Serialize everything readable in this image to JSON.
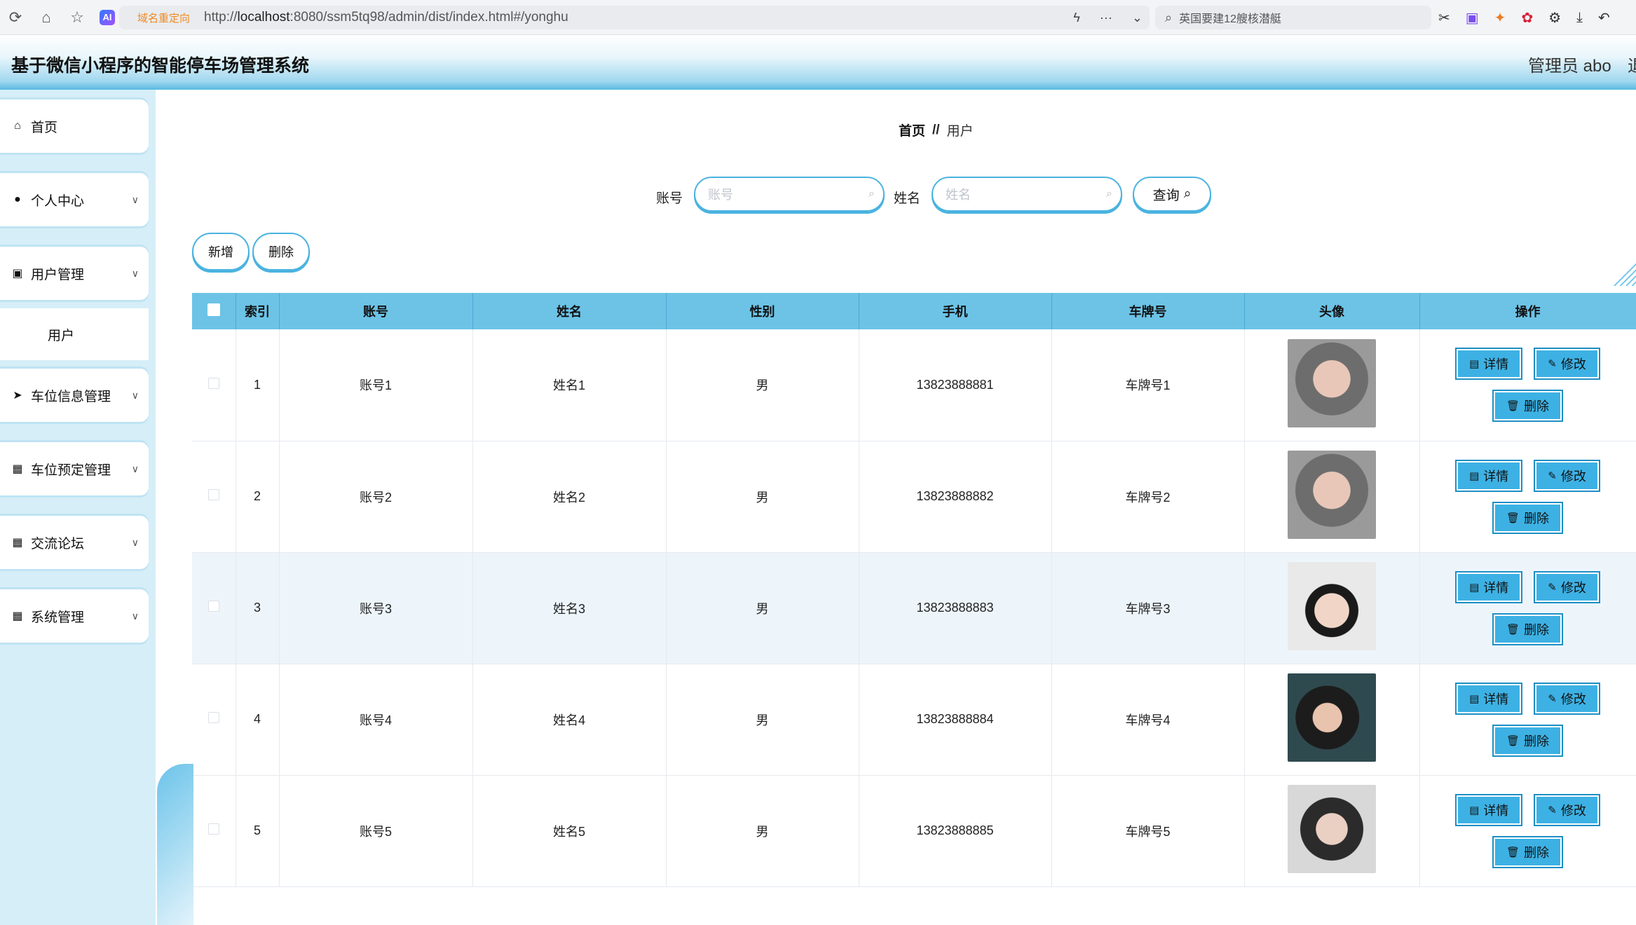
{
  "browser": {
    "redirect_tag": "域名重定向",
    "url_prefix": "http://",
    "url_host": "localhost",
    "url_rest": ":8080/ssm5tq98/admin/dist/index.html#/yonghu",
    "search_text": "英国要建12艘核潜艇",
    "ai_label": "AI"
  },
  "header": {
    "title": "基于微信小程序的智能停车场管理系统",
    "admin": "管理员 abo",
    "exit": "退"
  },
  "sidebar": {
    "items": [
      {
        "label": "首页"
      },
      {
        "label": "个人中心"
      },
      {
        "label": "用户管理"
      },
      {
        "label": "用户"
      },
      {
        "label": "车位信息管理"
      },
      {
        "label": "车位预定管理"
      },
      {
        "label": "交流论坛"
      },
      {
        "label": "系统管理"
      }
    ]
  },
  "breadcrumb": {
    "home": "首页",
    "sep": "//",
    "current": "用户"
  },
  "search": {
    "account_label": "账号",
    "account_placeholder": "账号",
    "name_label": "姓名",
    "name_placeholder": "姓名",
    "query_label": "查询"
  },
  "actions": {
    "add": "新增",
    "delete": "删除"
  },
  "table": {
    "headers": [
      "索引",
      "账号",
      "姓名",
      "性别",
      "手机",
      "车牌号",
      "头像",
      "操作"
    ],
    "rows": [
      {
        "index": "1",
        "account": "账号1",
        "name": "姓名1",
        "gender": "男",
        "phone": "13823888881",
        "plate": "车牌号1"
      },
      {
        "index": "2",
        "account": "账号2",
        "name": "姓名2",
        "gender": "男",
        "phone": "13823888882",
        "plate": "车牌号2"
      },
      {
        "index": "3",
        "account": "账号3",
        "name": "姓名3",
        "gender": "男",
        "phone": "13823888883",
        "plate": "车牌号3"
      },
      {
        "index": "4",
        "account": "账号4",
        "name": "姓名4",
        "gender": "男",
        "phone": "13823888884",
        "plate": "车牌号4"
      },
      {
        "index": "5",
        "account": "账号5",
        "name": "姓名5",
        "gender": "男",
        "phone": "13823888885",
        "plate": "车牌号5"
      }
    ],
    "op_detail": "详情",
    "op_edit": "修改",
    "op_delete": "删除"
  }
}
